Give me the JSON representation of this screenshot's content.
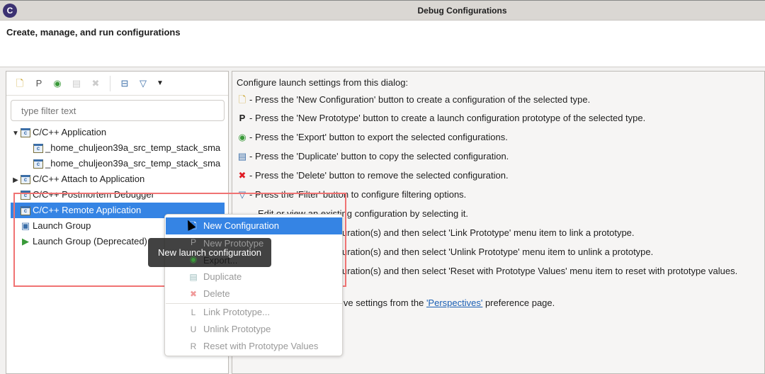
{
  "window": {
    "title": "Debug Configurations",
    "logo": "C"
  },
  "header": {
    "title": "Create, manage, and run configurations"
  },
  "toolbar": {
    "icons": [
      "new-configuration-icon",
      "new-prototype-icon",
      "export-icon",
      "duplicate-icon",
      "delete-icon",
      "collapse-all-icon",
      "filter-icon",
      "dropdown-icon"
    ]
  },
  "filter": {
    "placeholder": "type filter text"
  },
  "tree": [
    {
      "label": "C/C++ Application",
      "expanded": true
    },
    {
      "label": "_home_chuljeon39a_src_temp_stack_sma"
    },
    {
      "label": "_home_chuljeon39a_src_temp_stack_sma"
    },
    {
      "label": "C/C++ Attach to Application",
      "expanded": false
    },
    {
      "label": "C/C++ Postmortem Debugger"
    },
    {
      "label": "C/C++ Remote Application",
      "selected": true
    },
    {
      "label": "Launch Group"
    },
    {
      "label": "Launch Group (Deprecated)"
    }
  ],
  "right": {
    "intro": "Configure launch settings from this dialog:",
    "lines": [
      "- Press the 'New Configuration' button to create a configuration of the selected type.",
      "- Press the 'New Prototype' button to create a launch configuration prototype of the selected type.",
      "- Press the 'Export' button to export the selected configurations.",
      "- Press the 'Duplicate' button to copy the selected configuration.",
      "- Press the 'Delete' button to remove the selected configuration.",
      "- Press the 'Filter' button to configure filtering options."
    ],
    "edit": "Edit or view an existing configuration by selecting it.",
    "frag_link": "uration(s) and then select 'Link Prototype' menu item to link a prototype.",
    "frag_unlink": "uration(s) and then select 'Unlink Prototype' menu item to unlink a prototype.",
    "frag_reset": "uration(s) and then select 'Reset with Prototype Values' menu item to reset with prototype values.",
    "persp_pre": "ive settings from the ",
    "persp_link": "'Perspectives'",
    "persp_post": " preference page."
  },
  "menu": [
    {
      "label": "New Configuration",
      "enabled": true,
      "highlighted": true
    },
    {
      "label": "New Prototype",
      "enabled": false
    },
    {
      "label": "Export...",
      "enabled": true
    },
    {
      "label": "Duplicate",
      "enabled": false
    },
    {
      "label": "Delete",
      "enabled": false
    },
    {
      "label": "Link Prototype...",
      "enabled": false
    },
    {
      "label": "Unlink Prototype",
      "enabled": false
    },
    {
      "label": "Reset with Prototype Values",
      "enabled": false
    }
  ],
  "tooltip": "New launch configuration",
  "colors": {
    "selection": "#3584e4",
    "annotation_box": "#f07373",
    "link": "#1a5fb4"
  }
}
